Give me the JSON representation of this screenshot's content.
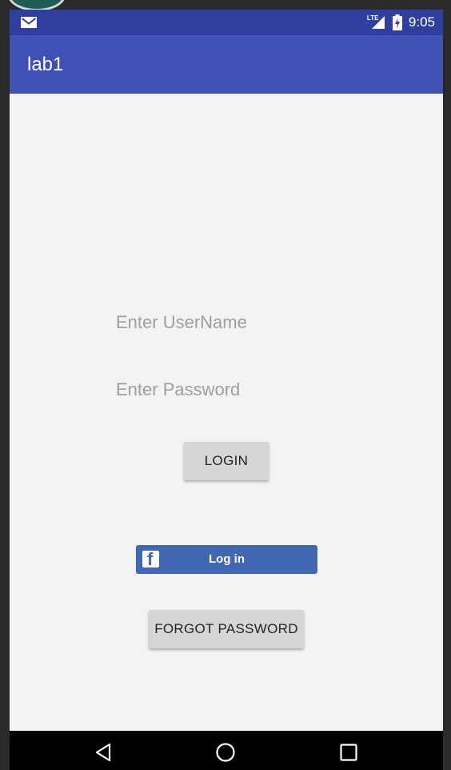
{
  "status_bar": {
    "time": "9:05",
    "network_label": "LTE",
    "icons": [
      "mail-icon",
      "lte-signal-icon",
      "battery-charging-icon"
    ]
  },
  "app_bar": {
    "title": "lab1",
    "color": "#3f51b5",
    "status_color": "#303f9f"
  },
  "form": {
    "username_placeholder": "Enter UserName",
    "username_value": "",
    "password_placeholder": "Enter Password",
    "password_value": "",
    "login_label": "LOGIN"
  },
  "facebook": {
    "label": "Log in",
    "color": "#4267b2",
    "icon": "facebook-icon"
  },
  "forgot_password_label": "FORGOT PASSWORD",
  "nav_bar": {
    "icons": [
      "back-icon",
      "home-icon",
      "recents-icon"
    ]
  }
}
